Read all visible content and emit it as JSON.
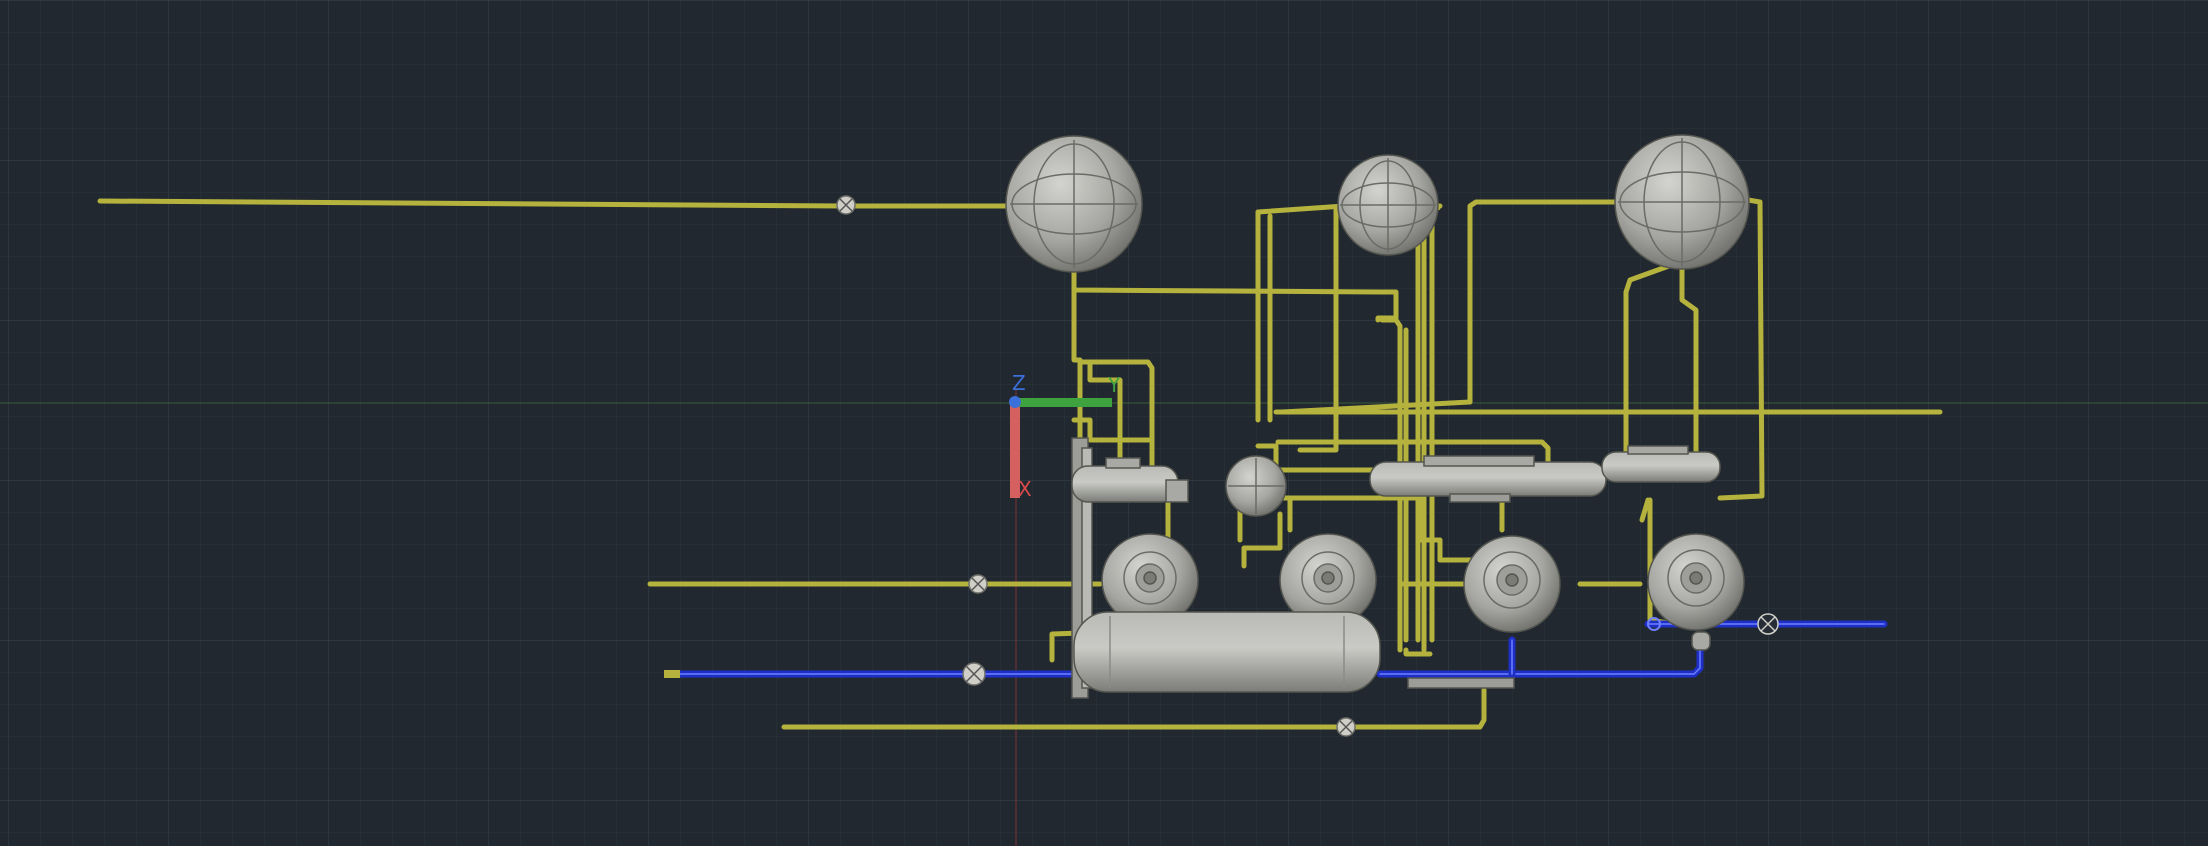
{
  "viewport": {
    "background": "#212830",
    "grid_minor_color": "#2a333d",
    "grid_major_color": "#343e49"
  },
  "ucs": {
    "x_label": "X",
    "y_label": "Y",
    "z_label": "Z",
    "x_color": "#d94b4b",
    "y_color": "#3ea33e",
    "z_color": "#3b6fd9"
  },
  "colors": {
    "process_pipe": "#b5b23d",
    "process_pipe_highlight": "#d8d468",
    "cooling_pipe": "#1e2fc8",
    "cooling_pipe_highlight": "#6f80ff",
    "equipment_fill": "#a9aaa5",
    "equipment_shade": "#74756f",
    "equipment_edge": "#55564f"
  },
  "icons": {
    "valve": "valve-icon",
    "ucs": "ucs-axis-icon"
  }
}
